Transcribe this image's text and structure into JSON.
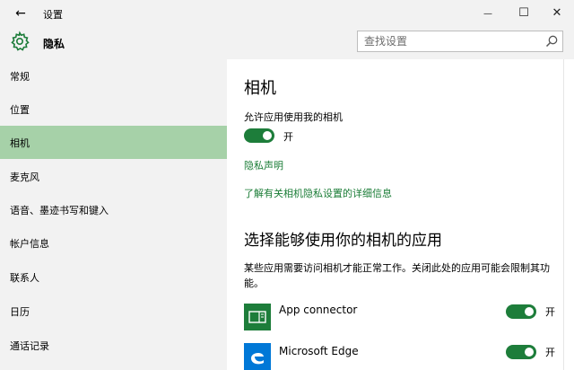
{
  "window": {
    "title": "设置",
    "back_glyph": "←",
    "minimize_glyph": "—",
    "maximize_glyph": "☐",
    "close_glyph": "✕"
  },
  "header": {
    "title": "隐私",
    "icon": "gear-icon"
  },
  "search": {
    "placeholder": "查找设置",
    "value": ""
  },
  "sidebar": {
    "items": [
      {
        "label": "常规",
        "active": false
      },
      {
        "label": "位置",
        "active": false
      },
      {
        "label": "相机",
        "active": true
      },
      {
        "label": "麦克风",
        "active": false
      },
      {
        "label": "语音、墨迹书写和键入",
        "active": false
      },
      {
        "label": "帐户信息",
        "active": false
      },
      {
        "label": "联系人",
        "active": false
      },
      {
        "label": "日历",
        "active": false
      },
      {
        "label": "通话记录",
        "active": false
      }
    ]
  },
  "main": {
    "title": "相机",
    "allow_label": "允许应用使用我的相机",
    "allow_toggle": {
      "state": "开",
      "on": true
    },
    "privacy_link": "隐私声明",
    "details_link": "了解有关相机隐私设置的详细信息",
    "section_title": "选择能够使用你的相机的应用",
    "section_desc": "某些应用需要访问相机才能正常工作。关闭此处的应用可能会限制其功能。",
    "apps": [
      {
        "name": "App connector",
        "icon": "app-connector-icon",
        "toggle": "开",
        "on": true
      },
      {
        "name": "Microsoft Edge",
        "icon": "edge-icon",
        "toggle": "开",
        "on": true
      }
    ]
  },
  "colors": {
    "accent_green": "#1d7d3a",
    "sidebar_active": "#a6d1a8",
    "link_green": "#1a7c36",
    "chrome_gray": "#f2f2f2",
    "app_tile_green": "#1d7d3a",
    "edge_blue": "#0078d7"
  }
}
